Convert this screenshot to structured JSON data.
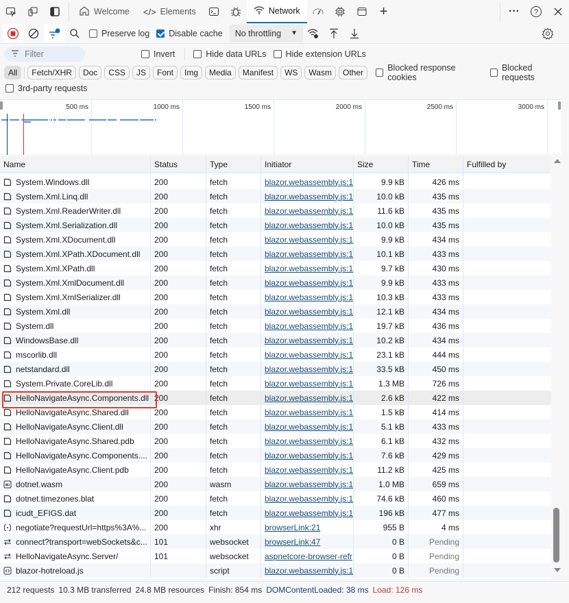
{
  "tabbar": {
    "tabs": [
      {
        "label": "Welcome",
        "icon": "home-icon"
      },
      {
        "label": "Elements",
        "icon": "code-icon"
      },
      {
        "label": "",
        "icon": "console-icon"
      },
      {
        "label": "",
        "icon": "bug-icon"
      },
      {
        "label": "Network",
        "icon": "wifi-icon",
        "active": true
      },
      {
        "label": "",
        "icon": "performance-icon"
      },
      {
        "label": "",
        "icon": "memory-chip-icon"
      },
      {
        "label": "",
        "icon": "application-icon"
      }
    ]
  },
  "toolbar": {
    "preserve_log": {
      "label": "Preserve log",
      "checked": false
    },
    "disable_cache": {
      "label": "Disable cache",
      "checked": true
    },
    "throttling": "No throttling"
  },
  "filters": {
    "placeholder": "Filter",
    "invert": "Invert",
    "hide_data_urls": "Hide data URLs",
    "hide_extension_urls": "Hide extension URLs",
    "types": [
      "All",
      "Fetch/XHR",
      "Doc",
      "CSS",
      "JS",
      "Font",
      "Img",
      "Media",
      "Manifest",
      "WS",
      "Wasm",
      "Other"
    ],
    "blocked_cookies": "Blocked response cookies",
    "blocked_requests": "Blocked requests",
    "third_party": "3rd-party requests"
  },
  "overview": {
    "ticks": [
      "500 ms",
      "1000 ms",
      "1500 ms",
      "2000 ms",
      "2500 ms",
      "3000 ms"
    ],
    "colors": {
      "dom": "#1a3d6e",
      "load": "#c0392b",
      "bar": "#5b8fd9"
    }
  },
  "table": {
    "headers": [
      "Name",
      "Status",
      "Type",
      "Initiator",
      "Size",
      "Time",
      "Fulfilled by"
    ],
    "rows": [
      {
        "name": "System.Windows.dll",
        "status": "200",
        "type": "fetch",
        "initiator": "blazor.webassembly.js:1.",
        "size": "9.9 kB",
        "time": "426 ms",
        "icon": "file"
      },
      {
        "name": "System.Xml.Linq.dll",
        "status": "200",
        "type": "fetch",
        "initiator": "blazor.webassembly.js:1.",
        "size": "10.0 kB",
        "time": "435 ms",
        "icon": "file"
      },
      {
        "name": "System.Xml.ReaderWriter.dll",
        "status": "200",
        "type": "fetch",
        "initiator": "blazor.webassembly.js:1.",
        "size": "11.6 kB",
        "time": "435 ms",
        "icon": "file"
      },
      {
        "name": "System.Xml.Serialization.dll",
        "status": "200",
        "type": "fetch",
        "initiator": "blazor.webassembly.js:1.",
        "size": "10.0 kB",
        "time": "435 ms",
        "icon": "file"
      },
      {
        "name": "System.Xml.XDocument.dll",
        "status": "200",
        "type": "fetch",
        "initiator": "blazor.webassembly.js:1.",
        "size": "9.9 kB",
        "time": "434 ms",
        "icon": "file"
      },
      {
        "name": "System.Xml.XPath.XDocument.dll",
        "status": "200",
        "type": "fetch",
        "initiator": "blazor.webassembly.js:1.",
        "size": "10.1 kB",
        "time": "433 ms",
        "icon": "file"
      },
      {
        "name": "System.Xml.XPath.dll",
        "status": "200",
        "type": "fetch",
        "initiator": "blazor.webassembly.js:1.",
        "size": "9.7 kB",
        "time": "430 ms",
        "icon": "file"
      },
      {
        "name": "System.Xml.XmlDocument.dll",
        "status": "200",
        "type": "fetch",
        "initiator": "blazor.webassembly.js:1.",
        "size": "9.9 kB",
        "time": "433 ms",
        "icon": "file"
      },
      {
        "name": "System.Xml.XmlSerializer.dll",
        "status": "200",
        "type": "fetch",
        "initiator": "blazor.webassembly.js:1.",
        "size": "10.3 kB",
        "time": "433 ms",
        "icon": "file"
      },
      {
        "name": "System.Xml.dll",
        "status": "200",
        "type": "fetch",
        "initiator": "blazor.webassembly.js:1.",
        "size": "12.1 kB",
        "time": "434 ms",
        "icon": "file"
      },
      {
        "name": "System.dll",
        "status": "200",
        "type": "fetch",
        "initiator": "blazor.webassembly.js:1.",
        "size": "19.7 kB",
        "time": "436 ms",
        "icon": "file"
      },
      {
        "name": "WindowsBase.dll",
        "status": "200",
        "type": "fetch",
        "initiator": "blazor.webassembly.js:1.",
        "size": "10.2 kB",
        "time": "434 ms",
        "icon": "file"
      },
      {
        "name": "mscorlib.dll",
        "status": "200",
        "type": "fetch",
        "initiator": "blazor.webassembly.js:1.",
        "size": "23.1 kB",
        "time": "444 ms",
        "icon": "file"
      },
      {
        "name": "netstandard.dll",
        "status": "200",
        "type": "fetch",
        "initiator": "blazor.webassembly.js:1.",
        "size": "33.5 kB",
        "time": "450 ms",
        "icon": "file"
      },
      {
        "name": "System.Private.CoreLib.dll",
        "status": "200",
        "type": "fetch",
        "initiator": "blazor.webassembly.js:1.",
        "size": "1.3 MB",
        "time": "726 ms",
        "icon": "file"
      },
      {
        "name": "HelloNavigateAsync.Components.dll",
        "status": "200",
        "type": "fetch",
        "initiator": "blazor.webassembly.js:1.",
        "size": "2.6 kB",
        "time": "422 ms",
        "icon": "file",
        "selected": true
      },
      {
        "name": "HelloNavigateAsync.Shared.dll",
        "status": "200",
        "type": "fetch",
        "initiator": "blazor.webassembly.js:1.",
        "size": "1.5 kB",
        "time": "414 ms",
        "icon": "file"
      },
      {
        "name": "HelloNavigateAsync.Client.dll",
        "status": "200",
        "type": "fetch",
        "initiator": "blazor.webassembly.js:1.",
        "size": "5.1 kB",
        "time": "433 ms",
        "icon": "file"
      },
      {
        "name": "HelloNavigateAsync.Shared.pdb",
        "status": "200",
        "type": "fetch",
        "initiator": "blazor.webassembly.js:1.",
        "size": "6.1 kB",
        "time": "432 ms",
        "icon": "file"
      },
      {
        "name": "HelloNavigateAsync.Components....",
        "status": "200",
        "type": "fetch",
        "initiator": "blazor.webassembly.js:1.",
        "size": "7.6 kB",
        "time": "429 ms",
        "icon": "file"
      },
      {
        "name": "HelloNavigateAsync.Client.pdb",
        "status": "200",
        "type": "fetch",
        "initiator": "blazor.webassembly.js:1.",
        "size": "11.2 kB",
        "time": "425 ms",
        "icon": "file"
      },
      {
        "name": "dotnet.wasm",
        "status": "200",
        "type": "wasm",
        "initiator": "blazor.webassembly.js:1.",
        "size": "1.0 MB",
        "time": "659 ms",
        "icon": "wasm"
      },
      {
        "name": "dotnet.timezones.blat",
        "status": "200",
        "type": "fetch",
        "initiator": "blazor.webassembly.js:1.",
        "size": "74.6 kB",
        "time": "460 ms",
        "icon": "file"
      },
      {
        "name": "icudt_EFIGS.dat",
        "status": "200",
        "type": "fetch",
        "initiator": "blazor.webassembly.js:1.",
        "size": "196 kB",
        "time": "477 ms",
        "icon": "file"
      },
      {
        "name": "negotiate?requestUrl=https%3A%...",
        "status": "200",
        "type": "xhr",
        "initiator": "browserLink:21",
        "size": "955 B",
        "time": "4 ms",
        "icon": "xhr"
      },
      {
        "name": "connect?transport=webSockets&c...",
        "status": "101",
        "type": "websocket",
        "initiator": "browserLink:47",
        "size": "0 B",
        "time": "Pending",
        "icon": "ws"
      },
      {
        "name": "HelloNavigateAsync.Server/",
        "status": "101",
        "type": "websocket",
        "initiator": "aspnetcore-browser-refr",
        "size": "0 B",
        "time": "Pending",
        "icon": "ws"
      },
      {
        "name": "blazor-hotreload.js",
        "status": "",
        "type": "script",
        "initiator": "blazor.webassembly.js:1.",
        "size": "0 B",
        "time": "Pending",
        "icon": "script"
      }
    ]
  },
  "status": {
    "requests": "212 requests",
    "transferred": "10.3 MB transferred",
    "resources": "24.8 MB resources",
    "finish": "Finish: 854 ms",
    "dom": "DOMContentLoaded: 38 ms",
    "load": "Load: 126 ms",
    "dom_color": "#1a3d6e",
    "load_color": "#c0392b"
  }
}
